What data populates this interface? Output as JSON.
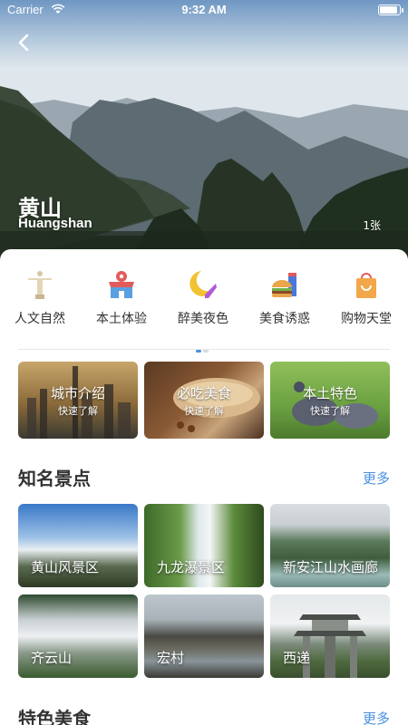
{
  "status": {
    "carrier": "Carrier",
    "time": "9:32 AM",
    "battery": 0.95
  },
  "hero": {
    "title": "黄山",
    "subtitle": "Huangshan",
    "photo_count": "1张"
  },
  "categories": [
    {
      "label": "人文自然",
      "icon": "statue-icon"
    },
    {
      "label": "本土体验",
      "icon": "shop-pin-icon"
    },
    {
      "label": "醉美夜色",
      "icon": "moon-heel-icon"
    },
    {
      "label": "美食诱惑",
      "icon": "burger-drink-icon"
    },
    {
      "label": "购物天堂",
      "icon": "shopping-bag-icon"
    }
  ],
  "quick_cards": [
    {
      "title": "城市介绍",
      "subtitle": "快速了解"
    },
    {
      "title": "必吃美食",
      "subtitle": "快速了解"
    },
    {
      "title": "本土特色",
      "subtitle": "快速了解"
    }
  ],
  "sections": {
    "spots_title": "知名景点",
    "food_title": "特色美食",
    "more": "更多"
  },
  "spots": [
    {
      "name": "黄山风景区"
    },
    {
      "name": "九龙瀑景区"
    },
    {
      "name": "新安江山水画廊"
    },
    {
      "name": "齐云山"
    },
    {
      "name": "宏村"
    },
    {
      "name": "西递"
    }
  ],
  "colors": {
    "accent": "#4a90e2",
    "text": "#333333"
  }
}
